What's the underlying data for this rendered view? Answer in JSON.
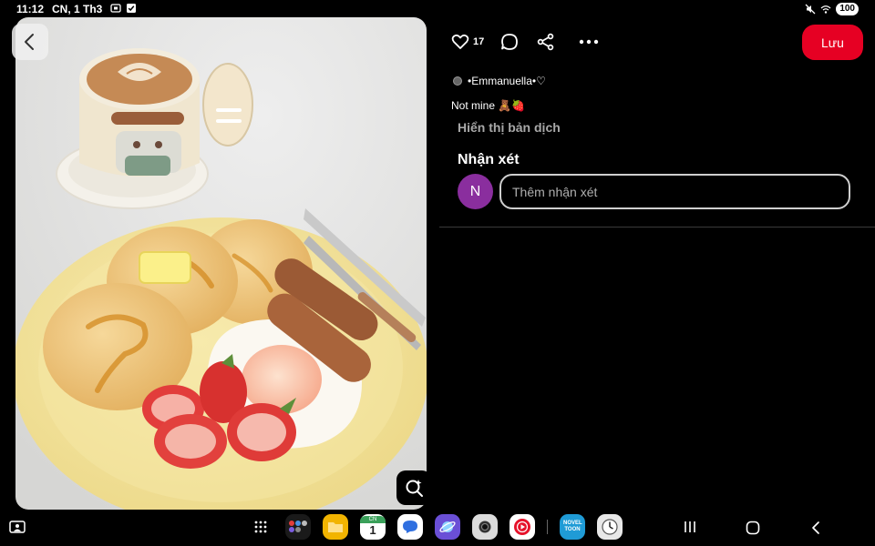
{
  "status": {
    "time": "11:12",
    "date": "CN, 1 Th3",
    "battery": "100",
    "icons": [
      "screenshot-icon",
      "check-icon",
      "mute-icon",
      "wifi-icon",
      "battery-icon"
    ]
  },
  "pin": {
    "like_count": "17",
    "save_label": "Lưu",
    "author": "•Emmanuella•♡",
    "description": "Not mine 🧸🍓",
    "translate_label": "Hiển thị bản dịch"
  },
  "comments": {
    "heading": "Nhận xét",
    "avatar_initial": "N",
    "placeholder": "Thêm nhận xét"
  },
  "colors": {
    "save_button": "#e60023",
    "avatar": "#8a2e9e",
    "background": "#000000"
  },
  "navbar": {
    "apps": [
      "apps-grid-icon",
      "multi-app-icon",
      "my-files-icon",
      "calendar-icon",
      "messages-icon",
      "internet-icon",
      "camera-icon",
      "youtube-music-icon",
      "noveltoon-icon",
      "clock-icon"
    ],
    "calendar_day_label": "CN",
    "calendar_day": "1",
    "noveltoon_label": "NOVEL TOON"
  }
}
